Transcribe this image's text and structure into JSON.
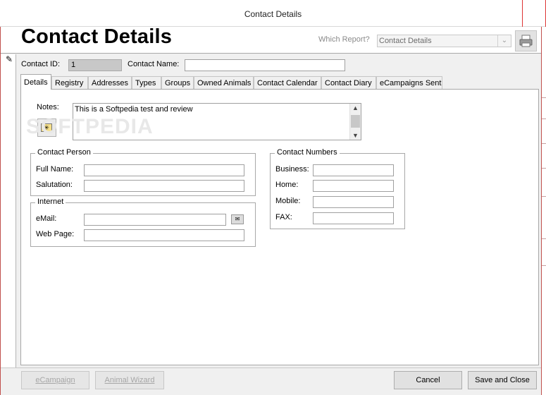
{
  "window": {
    "title": "Contact Details"
  },
  "header": {
    "title": "Contact Details",
    "which_report_label": "Which Report?",
    "report_select_value": "Contact Details"
  },
  "contact": {
    "id_label": "Contact ID:",
    "id_value": "1",
    "name_label": "Contact Name:",
    "name_value": ""
  },
  "tabs": [
    {
      "label": "Details",
      "active": true
    },
    {
      "label": "Registry"
    },
    {
      "label": "Addresses"
    },
    {
      "label": "Types"
    },
    {
      "label": "Groups"
    },
    {
      "label": "Owned Animals"
    },
    {
      "label": "Contact Calendar"
    },
    {
      "label": "Contact Diary"
    },
    {
      "label": "eCampaigns Sent"
    }
  ],
  "notes": {
    "label": "Notes:",
    "value": "This is a Softpedia test and review"
  },
  "contact_person": {
    "title": "Contact Person",
    "full_name_label": "Full Name:",
    "salutation_label": "Salutation:"
  },
  "internet": {
    "title": "Internet",
    "email_label": "eMail:",
    "web_label": "Web Page:"
  },
  "contact_numbers": {
    "title": "Contact Numbers",
    "business_label": "Business:",
    "home_label": "Home:",
    "mobile_label": "Mobile:",
    "fax_label": "FAX:"
  },
  "watermark": "SOFTPEDIA",
  "buttons": {
    "ecampaign": "eCampaign",
    "animal_wizard": "Animal Wizard",
    "cancel": "Cancel",
    "save_close": "Save and Close"
  },
  "icons": [
    "printer-icon",
    "pencil-icon",
    "folder-icon",
    "email-icon",
    "chevron-down-icon"
  ]
}
